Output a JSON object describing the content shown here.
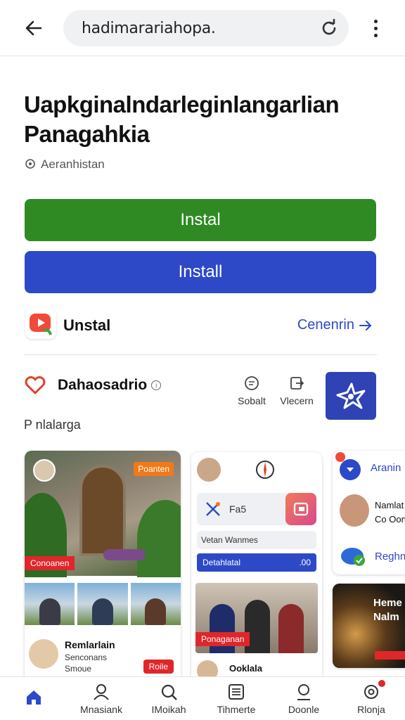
{
  "browser": {
    "url": "hadimarariahopa.",
    "back_icon": "arrow-left-icon",
    "reload_icon": "reload-icon",
    "menu_icon": "kebab-menu-icon"
  },
  "page": {
    "title": "Uapkginalndarleginlangarlian Panagahkia",
    "location": "Aeranhistan",
    "location_icon": "location-pin-icon"
  },
  "buttons": {
    "primary": "Instal",
    "secondary": "Install",
    "primary_color": "#2f8a24",
    "secondary_color": "#2d49c8"
  },
  "app_row": {
    "name": "Unstal",
    "link": "Cenenrin",
    "link_icon": "arrow-right-icon"
  },
  "section": {
    "title": "Dahaosadrio",
    "subtitle": "P nlalarga",
    "actions": [
      {
        "label": "Sobalt",
        "icon": "chat-icon"
      },
      {
        "label": "Vlecern",
        "icon": "share-icon"
      }
    ]
  },
  "cards": {
    "card1": {
      "badge_top": "Poanten",
      "badge_bottom": "Conoanen",
      "name": "Remlarlain",
      "sub1": "Senconans",
      "sub2": "Smoue",
      "pill": "Roile"
    },
    "card2": {
      "row1": "Fa5",
      "row2": "Vetan Wanmes",
      "bar_left": "Detahlatal",
      "bar_right": ".00",
      "badge": "Ponaganan",
      "name": "Ooklala"
    },
    "card3": {
      "title": "Aranin",
      "name1": "Namlat",
      "name2": "Co Oon",
      "link": "Reghn"
    },
    "card4": {
      "headline1": "Heme",
      "headline2": "Nalm"
    }
  },
  "bottom_nav": [
    {
      "label": "",
      "icon": "home-icon",
      "active": true
    },
    {
      "label": "Mnasiank",
      "icon": "profile-icon"
    },
    {
      "label": "IMoikah",
      "icon": "search-icon"
    },
    {
      "label": "Tihmerte",
      "icon": "list-icon"
    },
    {
      "label": "Doonle",
      "icon": "account-icon"
    },
    {
      "label": "Rlonja",
      "icon": "settings-icon"
    }
  ]
}
